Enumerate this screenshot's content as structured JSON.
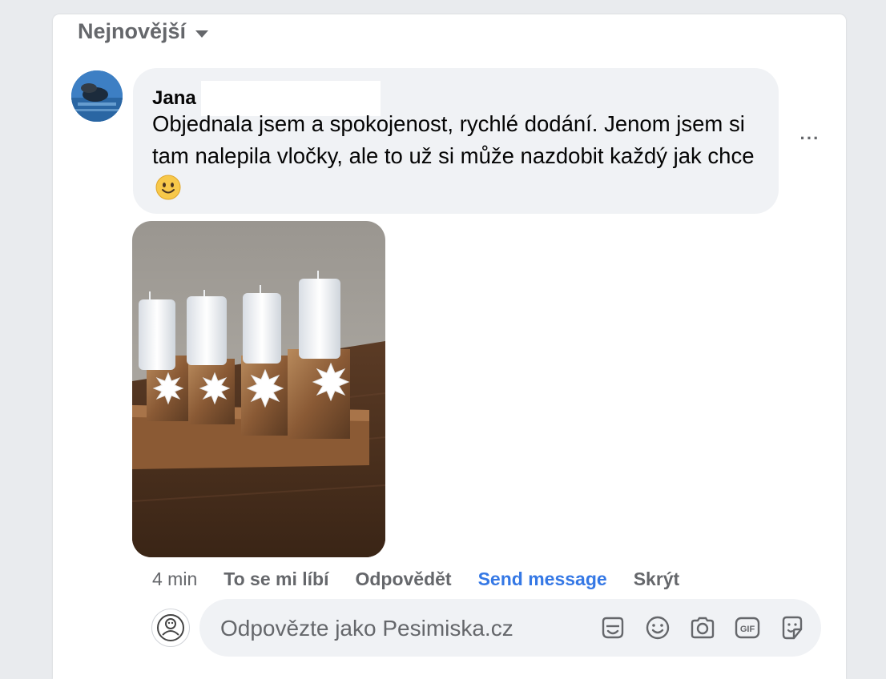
{
  "sort": {
    "label": "Nejnovější"
  },
  "comment": {
    "author": "Jana",
    "text": "Objednala jsem a spokojenost, rychlé dodání. Jenom jsem si tam nalepila vločky, ale to už si může nazdobit každý jak chce",
    "more_label": "···"
  },
  "actions": {
    "time": "4 min",
    "like": "To se mi líbí",
    "reply": "Odpovědět",
    "send_message": "Send message",
    "hide": "Skrýt"
  },
  "reply": {
    "placeholder": "Odpovězte jako Pesimiska.cz",
    "value": "",
    "tools": [
      "sticker-icon",
      "emoji-icon",
      "camera-icon",
      "gif-icon",
      "avatar-sticker-icon"
    ],
    "gif_label": "GIF"
  },
  "colors": {
    "background": "#e9ebee",
    "bubble": "#f0f2f5",
    "secondary_text": "#65676b",
    "link_blue": "#3578e5"
  }
}
